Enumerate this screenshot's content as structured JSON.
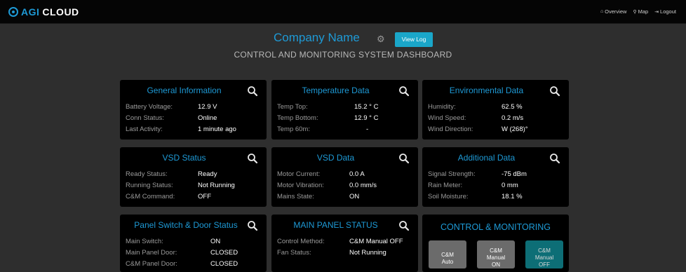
{
  "nav": {
    "brand_a": "AGI",
    "brand_b": "CLOUD",
    "links": [
      {
        "icon": "home-icon",
        "glyph": "⌂",
        "label": "Overview"
      },
      {
        "icon": "map-pin-icon",
        "glyph": "⚲",
        "label": "Map"
      },
      {
        "icon": "logout-icon",
        "glyph": "⇥",
        "label": "Logout"
      }
    ]
  },
  "header": {
    "company": "Company Name",
    "view_log": "View Log",
    "subtitle": "CONTROL AND MONITORING SYSTEM DASHBOARD"
  },
  "panels": {
    "general": {
      "title": "General Information",
      "rows": [
        {
          "label": "Battery Voltage:",
          "value": "12.9 V"
        },
        {
          "label": "Conn Status:",
          "value": "Online"
        },
        {
          "label": "Last Activity:",
          "value": "1 minute ago"
        }
      ]
    },
    "temperature": {
      "title": "Temperature Data",
      "rows": [
        {
          "label": "Temp Top:",
          "value": "15.2 ° C"
        },
        {
          "label": "Temp Bottom:",
          "value": "12.9 ° C"
        },
        {
          "label": "Temp 60m:",
          "value": "-"
        }
      ]
    },
    "environmental": {
      "title": "Environmental Data",
      "rows": [
        {
          "label": "Humidity:",
          "value": "62.5 %"
        },
        {
          "label": "Wind Speed:",
          "value": "0.2 m/s"
        },
        {
          "label": "Wind Direction:",
          "value": "W (268)°"
        }
      ]
    },
    "vsd_status": {
      "title": "VSD Status",
      "rows": [
        {
          "label": "Ready Status:",
          "value": "Ready"
        },
        {
          "label": "Running Status:",
          "value": "Not Running"
        },
        {
          "label": "C&M Command:",
          "value": "OFF"
        }
      ]
    },
    "vsd_data": {
      "title": "VSD Data",
      "rows": [
        {
          "label": "Motor Current:",
          "value": "0.0 A"
        },
        {
          "label": "Motor Vibration:",
          "value": "0.0 mm/s"
        },
        {
          "label": "Mains State:",
          "value": "ON"
        }
      ]
    },
    "additional": {
      "title": "Additional Data",
      "rows": [
        {
          "label": "Signal Strength:",
          "value": "-75 dBm"
        },
        {
          "label": "Rain Meter:",
          "value": "0 mm"
        },
        {
          "label": "Soil Moisture:",
          "value": "18.1 %"
        }
      ]
    },
    "panel_switch": {
      "title": "Panel Switch & Door Status",
      "rows": [
        {
          "label": "Main Switch:",
          "value": "ON"
        },
        {
          "label": "Main Panel Door:",
          "value": "CLOSED"
        },
        {
          "label": "C&M Panel Door:",
          "value": "CLOSED"
        }
      ]
    },
    "main_panel": {
      "title": "MAIN PANEL STATUS",
      "rows": [
        {
          "label": "Control Method:",
          "value": "C&M Manual OFF"
        },
        {
          "label": "Fan Status:",
          "value": "Not Running"
        }
      ]
    },
    "control": {
      "title": "CONTROL & MONITORING",
      "buttons": [
        {
          "line1": "C&M",
          "line2": "Auto"
        },
        {
          "line1": "C&M",
          "line2": "Manual",
          "line3": "ON"
        },
        {
          "line1": "C&M",
          "line2": "Manual",
          "line3": "OFF"
        }
      ]
    }
  },
  "colors": {
    "accent": "#1e9ad6",
    "background": "#2e2e2e",
    "panel": "#000000",
    "button_grey": "#6b6b6b",
    "button_teal": "#0d6e76",
    "view_log_button": "#1aa6c9"
  }
}
